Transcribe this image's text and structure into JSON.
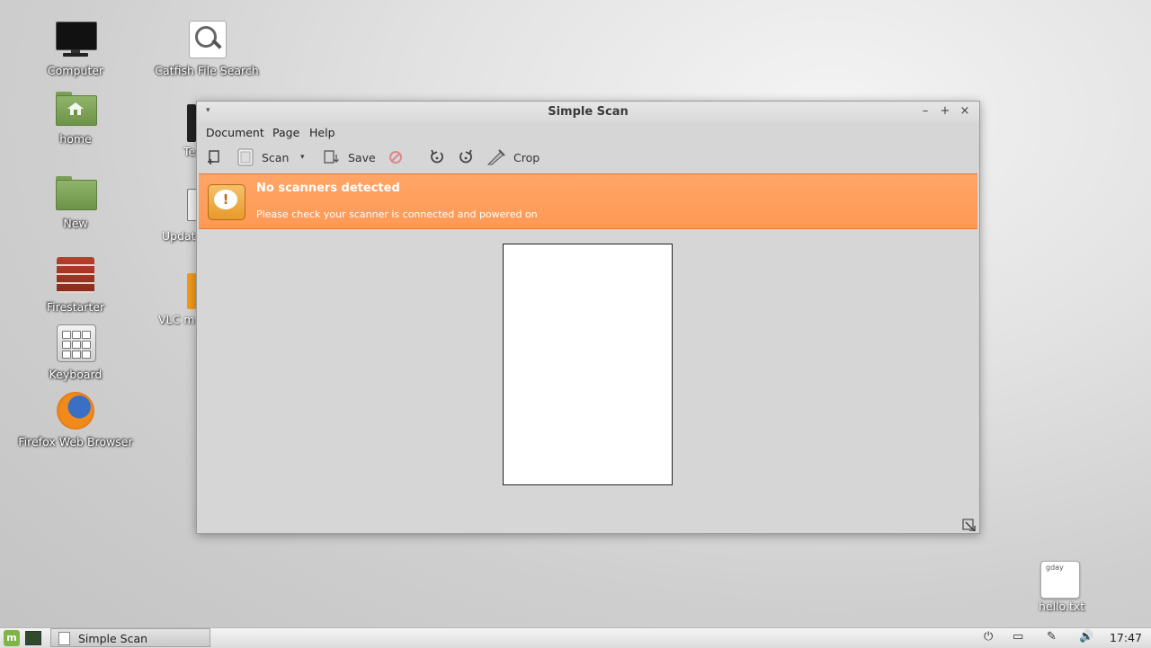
{
  "desktop": {
    "icons": [
      {
        "id": "computer",
        "label": "Computer"
      },
      {
        "id": "home",
        "label": "home"
      },
      {
        "id": "new",
        "label": "New"
      },
      {
        "id": "firestarter",
        "label": "Firestarter"
      },
      {
        "id": "keyboard",
        "label": "Keyboard"
      },
      {
        "id": "firefox",
        "label": "Firefox Web Browser"
      },
      {
        "id": "catfish",
        "label": "Catfish File Search"
      },
      {
        "id": "hello",
        "label": "hello.txt",
        "preview": "gday"
      }
    ],
    "partial_labels": [
      "Te",
      "Updat",
      "VLC m"
    ]
  },
  "window": {
    "title": "Simple Scan",
    "menu_arrow": "▾",
    "controls": {
      "minimize": "–",
      "maximize": "+",
      "close": "×"
    },
    "menus": [
      "Document",
      "Page",
      "Help"
    ],
    "toolbar": {
      "scan_label": "Scan",
      "scan_arrow": "▾",
      "save_label": "Save",
      "crop_label": "Crop"
    },
    "infobar": {
      "title": "No scanners detected",
      "message": "Please check your scanner is connected and powered on",
      "icon_glyph": "!"
    }
  },
  "taskbar": {
    "menu_glyph": "m",
    "task_label": "Simple Scan",
    "clock": "17:47",
    "tray": {
      "power": "⏻",
      "battery": "▭",
      "network": "✎",
      "volume": "🔊"
    }
  },
  "colors": {
    "infobar_bg": "#ff9f5e",
    "window_bg": "#d6d6d6",
    "mint_green": "#7fb446"
  }
}
